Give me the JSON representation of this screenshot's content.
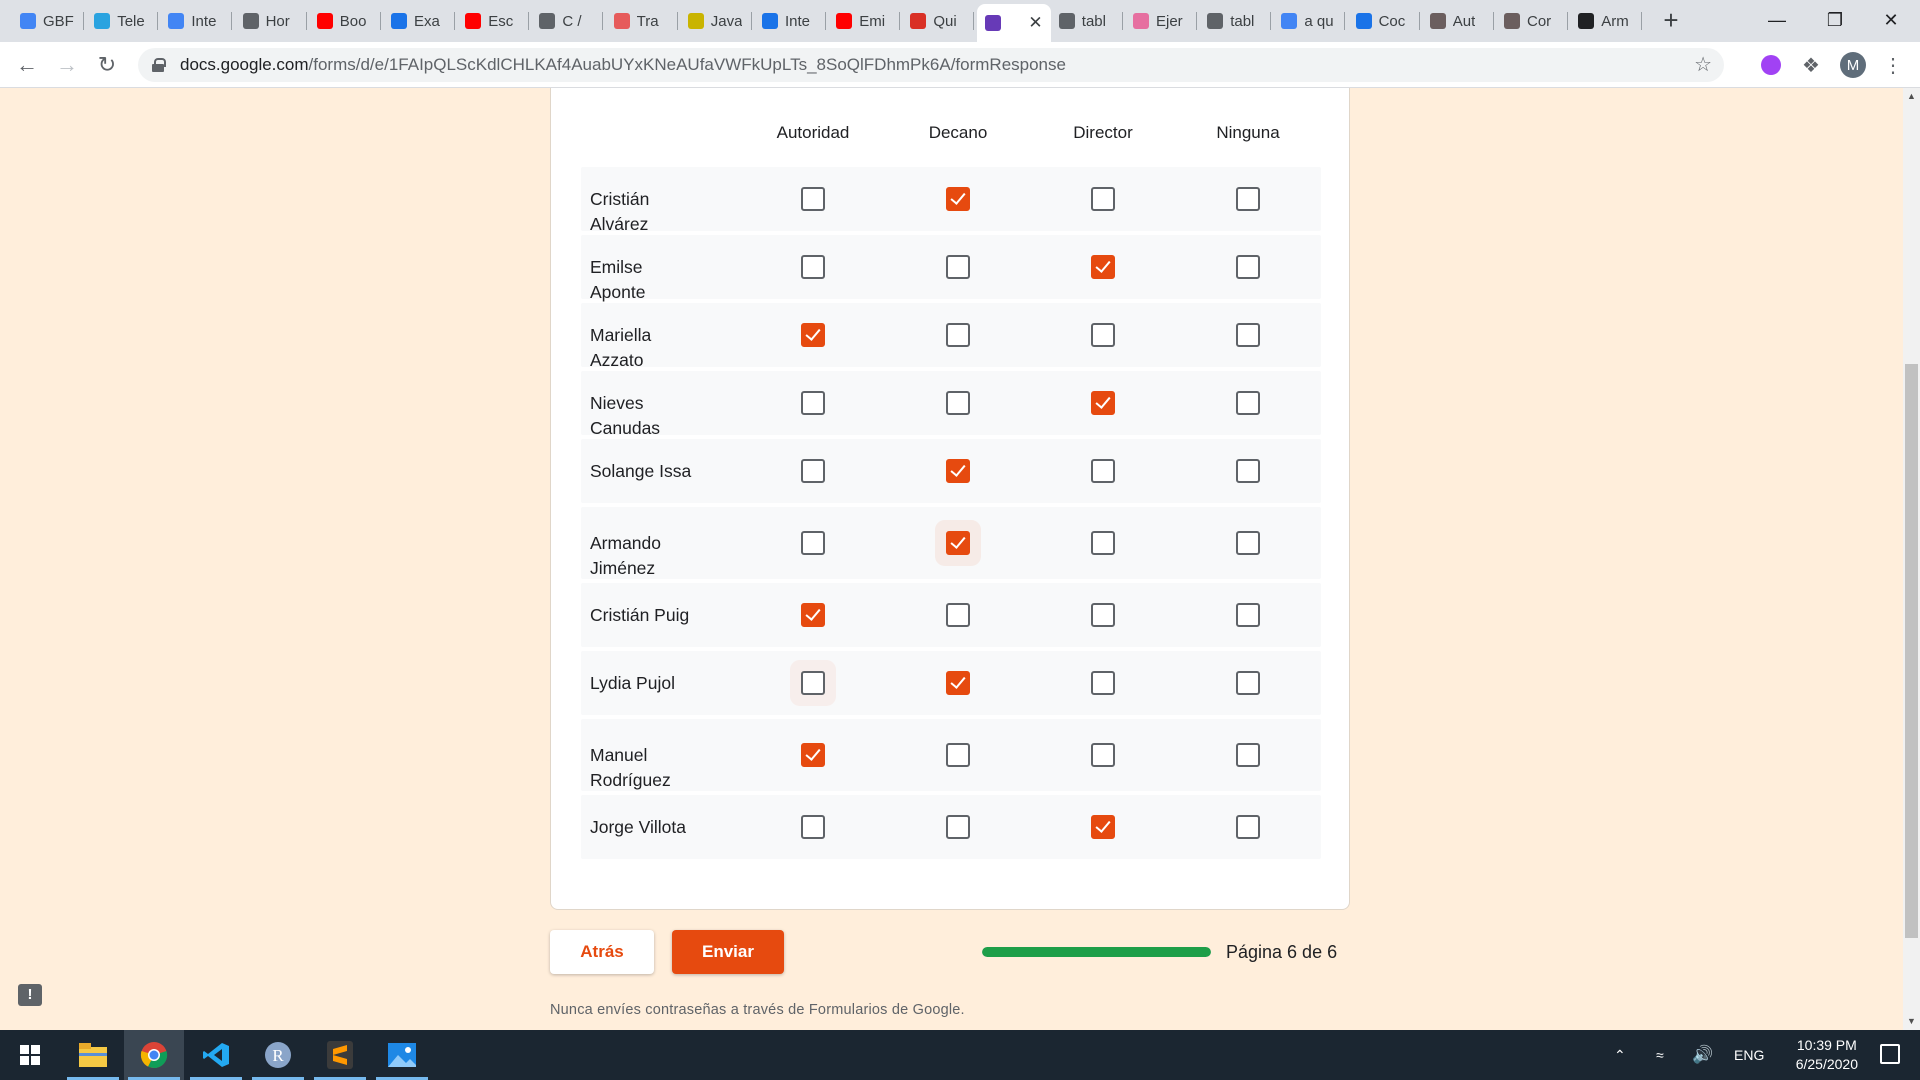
{
  "browser": {
    "tabs": [
      {
        "title": "GBF",
        "icon": "cloud-icon",
        "color": "#4285f4"
      },
      {
        "title": "Tele",
        "icon": "telegram-icon",
        "color": "#2aa3e0"
      },
      {
        "title": "Inte",
        "icon": "docs-icon",
        "color": "#4285f4"
      },
      {
        "title": "Hor",
        "icon": "globe-icon",
        "color": "#5f6368"
      },
      {
        "title": "Boo",
        "icon": "youtube-icon",
        "color": "#ff0000"
      },
      {
        "title": "Exa",
        "icon": "classroom-icon",
        "color": "#1a73e8"
      },
      {
        "title": "Esc",
        "icon": "youtube-icon",
        "color": "#ff0000"
      },
      {
        "title": "C /",
        "icon": "codepen-icon",
        "color": "#5f6368"
      },
      {
        "title": "Tra",
        "icon": "openai-icon",
        "color": "#e65b5b"
      },
      {
        "title": "Java",
        "icon": "javascript-icon",
        "color": "#c9b400"
      },
      {
        "title": "Inte",
        "icon": "classroom-icon",
        "color": "#1a73e8"
      },
      {
        "title": "Emi",
        "icon": "youtube-icon",
        "color": "#ff0000"
      },
      {
        "title": "Qui",
        "icon": "gmail-icon",
        "color": "#d93025"
      },
      {
        "title": "",
        "icon": "forms-icon",
        "color": "#673ab7"
      },
      {
        "title": "tabl",
        "icon": "globe-icon",
        "color": "#5f6368"
      },
      {
        "title": "Ejer",
        "icon": "slack-icon",
        "color": "#e66fa0"
      },
      {
        "title": "tabl",
        "icon": "globe-icon",
        "color": "#5f6368"
      },
      {
        "title": "a qu",
        "icon": "google-icon",
        "color": "#4285f4"
      },
      {
        "title": "Coc",
        "icon": "calendar-icon",
        "color": "#1a73e8"
      },
      {
        "title": "Aut",
        "icon": "brain-icon",
        "color": "#6b5e5e"
      },
      {
        "title": "Cor",
        "icon": "brain-icon",
        "color": "#6b5e5e"
      },
      {
        "title": "Arm",
        "icon": "font-a-icon",
        "color": "#202124"
      }
    ],
    "active_tab_index": 13,
    "url_host": "docs.google.com",
    "url_path": "/forms/d/e/1FAIpQLScKdlCHLKAf4AuabUYxKNeAUfaVWFkUpLTs_8SoQlFDhmPk6A/formResponse",
    "avatar_initial": "M"
  },
  "form": {
    "columns": [
      "Autoridad",
      "Decano",
      "Director",
      "Ninguna"
    ],
    "rows": [
      {
        "label": "Cristián Alvárez",
        "checked": [
          false,
          true,
          false,
          false
        ]
      },
      {
        "label": "Emilse Aponte",
        "checked": [
          false,
          false,
          true,
          false
        ]
      },
      {
        "label": "Mariella Azzato",
        "checked": [
          true,
          false,
          false,
          false
        ]
      },
      {
        "label": "Nieves Canudas",
        "checked": [
          false,
          false,
          true,
          false
        ]
      },
      {
        "label": "Solange Issa",
        "checked": [
          false,
          true,
          false,
          false
        ]
      },
      {
        "label": "Armando Jiménez",
        "checked": [
          false,
          true,
          false,
          false
        ]
      },
      {
        "label": "Cristián Puig",
        "checked": [
          true,
          false,
          false,
          false
        ]
      },
      {
        "label": "Lydia Pujol",
        "checked": [
          false,
          true,
          false,
          false
        ]
      },
      {
        "label": "Manuel Rodríguez",
        "checked": [
          true,
          false,
          false,
          false
        ]
      },
      {
        "label": "Jorge Villota",
        "checked": [
          false,
          false,
          true,
          false
        ]
      }
    ],
    "back_label": "Atrás",
    "submit_label": "Enviar",
    "progress_fraction": 1.0,
    "page_indicator": "Página 6 de 6",
    "footer_note": "Nunca envíes contraseñas a través de Formularios de Google.",
    "accent_color": "#e64a0f",
    "progress_color": "#1e9e48"
  },
  "taskbar": {
    "apps": [
      "windows-start-icon",
      "file-explorer-icon",
      "chrome-icon",
      "vscode-icon",
      "r-icon",
      "sublime-icon",
      "photos-icon"
    ],
    "language": "ENG",
    "time": "10:39 PM",
    "date": "6/25/2020"
  }
}
